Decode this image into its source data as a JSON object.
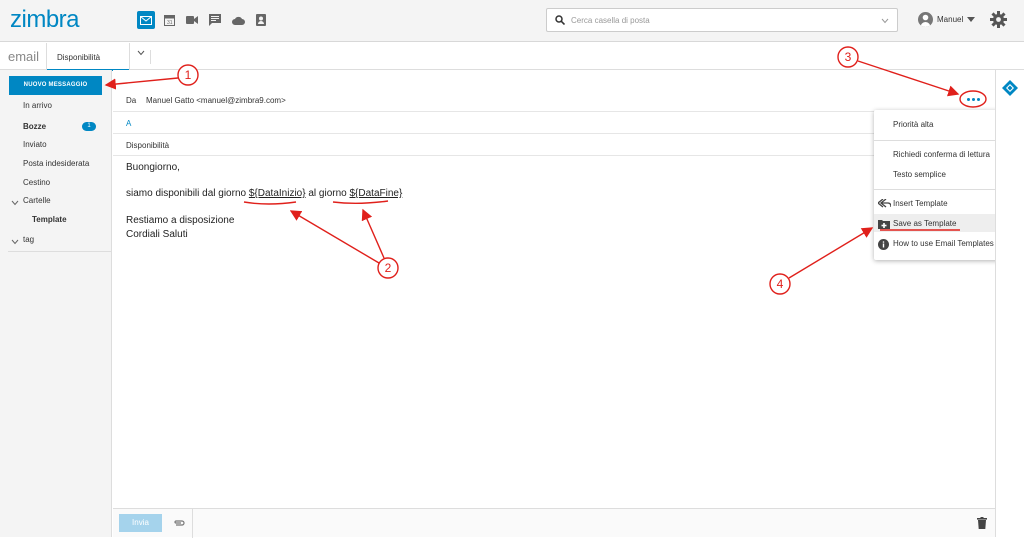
{
  "app": {
    "logo": "zimbra"
  },
  "header": {
    "apps": [
      "mail-icon",
      "calendar-icon",
      "video-icon",
      "chat-icon",
      "cloud-icon",
      "contacts-icon"
    ],
    "search_placeholder": "Cerca casella di posta",
    "user_name": "Manuel"
  },
  "tabs": {
    "section": "email",
    "active": "Disponibilità"
  },
  "sidebar": {
    "new_message": "NUOVO MESSAGGIO",
    "folders": [
      "In arrivo",
      "Bozze",
      "Inviato",
      "Posta indesiderata",
      "Cestino"
    ],
    "drafts_count": "1",
    "cartelle": "Cartelle",
    "template": "Template",
    "tag": "tag"
  },
  "compose": {
    "from_label": "Da",
    "from_value": "Manuel Gatto <manuel@zimbra9.com>",
    "to_label": "A",
    "subject": "Disponibilità",
    "body": {
      "greeting": "Buongiorno,",
      "line_pre": "siamo disponibili dal giorno ",
      "var_start": "${DataInizio}",
      "line_mid": " al giorno ",
      "var_end": "${DataFine}",
      "closing1": "Restiamo a disposizione",
      "closing2": "Cordiali Saluti"
    },
    "send": "Invia"
  },
  "menu": {
    "priority": "Priorità alta",
    "read_receipt": "Richiedi conferma di lettura",
    "plain_text": "Testo semplice",
    "insert_template": "Insert Template",
    "save_template": "Save as Template",
    "how_to": "How to use Email Templates"
  },
  "annotations": [
    "1",
    "2",
    "3",
    "4"
  ],
  "colors": {
    "accent": "#0087c3",
    "annotation": "#e0201b"
  }
}
